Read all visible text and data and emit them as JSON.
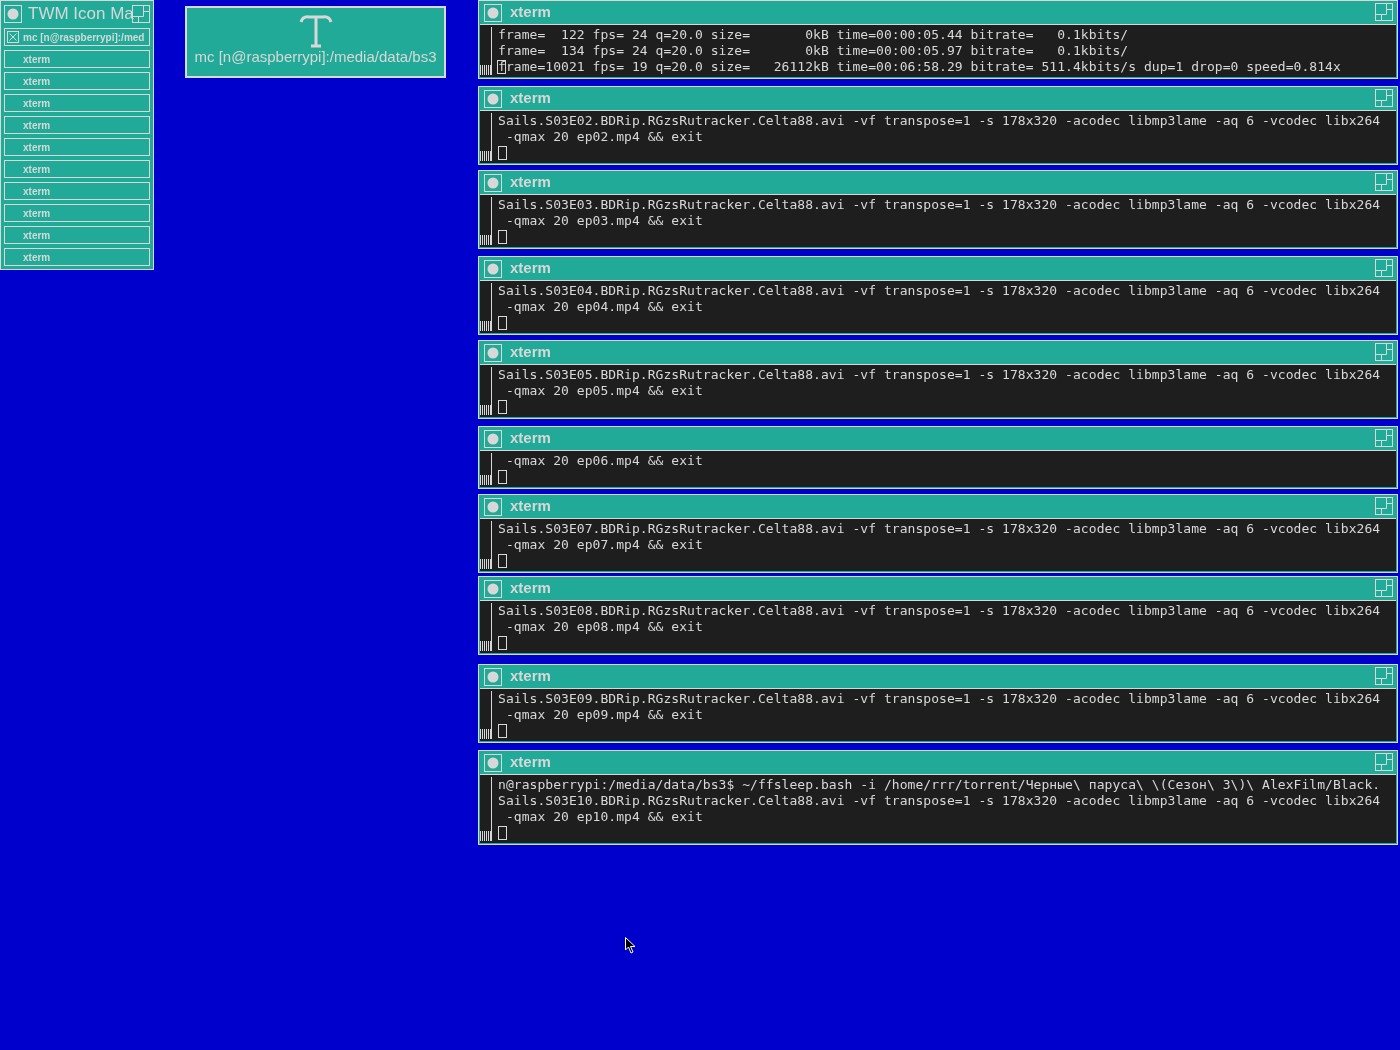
{
  "icon_manager": {
    "title": "TWM Icon Ma",
    "entries": [
      {
        "label": "mc [n@raspberrypi]:/med",
        "iconified": true
      },
      {
        "label": "xterm",
        "iconified": false
      },
      {
        "label": "xterm",
        "iconified": false
      },
      {
        "label": "xterm",
        "iconified": false
      },
      {
        "label": "xterm",
        "iconified": false
      },
      {
        "label": "xterm",
        "iconified": false
      },
      {
        "label": "xterm",
        "iconified": false
      },
      {
        "label": "xterm",
        "iconified": false
      },
      {
        "label": "xterm",
        "iconified": false
      },
      {
        "label": "xterm",
        "iconified": false
      },
      {
        "label": "xterm",
        "iconified": false
      }
    ]
  },
  "desktop_icon": {
    "label": "mc [n@raspberrypi]:/media/data/bs3"
  },
  "windows": [
    {
      "title": "xterm",
      "cursor_on_new_line": false,
      "lines": [
        "frame=  122 fps= 24 q=20.0 size=       0kB time=00:00:05.44 bitrate=   0.1kbits/",
        "frame=  134 fps= 24 q=20.0 size=       0kB time=00:00:05.97 bitrate=   0.1kbits/",
        "frame=10021 fps= 19 q=20.0 size=   26112kB time=00:06:58.29 bitrate= 511.4kbits/s dup=1 drop=0 speed=0.814x"
      ]
    },
    {
      "title": "xterm",
      "cursor_on_new_line": true,
      "lines": [
        "Sails.S03E02.BDRip.RGzsRutracker.Celta88.avi -vf transpose=1 -s 178x320 -acodec libmp3lame -aq 6 -vcodec libx264",
        " -qmax 20 ep02.mp4 && exit"
      ]
    },
    {
      "title": "xterm",
      "cursor_on_new_line": true,
      "lines": [
        "Sails.S03E03.BDRip.RGzsRutracker.Celta88.avi -vf transpose=1 -s 178x320 -acodec libmp3lame -aq 6 -vcodec libx264",
        " -qmax 20 ep03.mp4 && exit"
      ]
    },
    {
      "title": "xterm",
      "cursor_on_new_line": true,
      "lines": [
        "Sails.S03E04.BDRip.RGzsRutracker.Celta88.avi -vf transpose=1 -s 178x320 -acodec libmp3lame -aq 6 -vcodec libx264",
        " -qmax 20 ep04.mp4 && exit"
      ]
    },
    {
      "title": "xterm",
      "cursor_on_new_line": true,
      "lines": [
        "Sails.S03E05.BDRip.RGzsRutracker.Celta88.avi -vf transpose=1 -s 178x320 -acodec libmp3lame -aq 6 -vcodec libx264",
        " -qmax 20 ep05.mp4 && exit"
      ]
    },
    {
      "title": "xterm",
      "cursor_on_new_line": true,
      "lines": [
        " -qmax 20 ep06.mp4 && exit"
      ]
    },
    {
      "title": "xterm",
      "cursor_on_new_line": true,
      "lines": [
        "Sails.S03E07.BDRip.RGzsRutracker.Celta88.avi -vf transpose=1 -s 178x320 -acodec libmp3lame -aq 6 -vcodec libx264",
        " -qmax 20 ep07.mp4 && exit"
      ]
    },
    {
      "title": "xterm",
      "cursor_on_new_line": true,
      "lines": [
        "Sails.S03E08.BDRip.RGzsRutracker.Celta88.avi -vf transpose=1 -s 178x320 -acodec libmp3lame -aq 6 -vcodec libx264",
        " -qmax 20 ep08.mp4 && exit"
      ]
    },
    {
      "title": "xterm",
      "cursor_on_new_line": true,
      "lines": [
        "Sails.S03E09.BDRip.RGzsRutracker.Celta88.avi -vf transpose=1 -s 178x320 -acodec libmp3lame -aq 6 -vcodec libx264",
        " -qmax 20 ep09.mp4 && exit"
      ]
    },
    {
      "title": "xterm",
      "cursor_on_new_line": true,
      "lines": [
        "n@raspberrypi:/media/data/bs3$ ~/ffsleep.bash -i /home/rrr/torrent/Черные\\ паруса\\ \\(Сезон\\ 3\\)\\ AlexFilm/Black.",
        "Sails.S03E10.BDRip.RGzsRutracker.Celta88.avi -vf transpose=1 -s 178x320 -acodec libmp3lame -aq 6 -vcodec libx264",
        " -qmax 20 ep10.mp4 && exit"
      ]
    }
  ]
}
